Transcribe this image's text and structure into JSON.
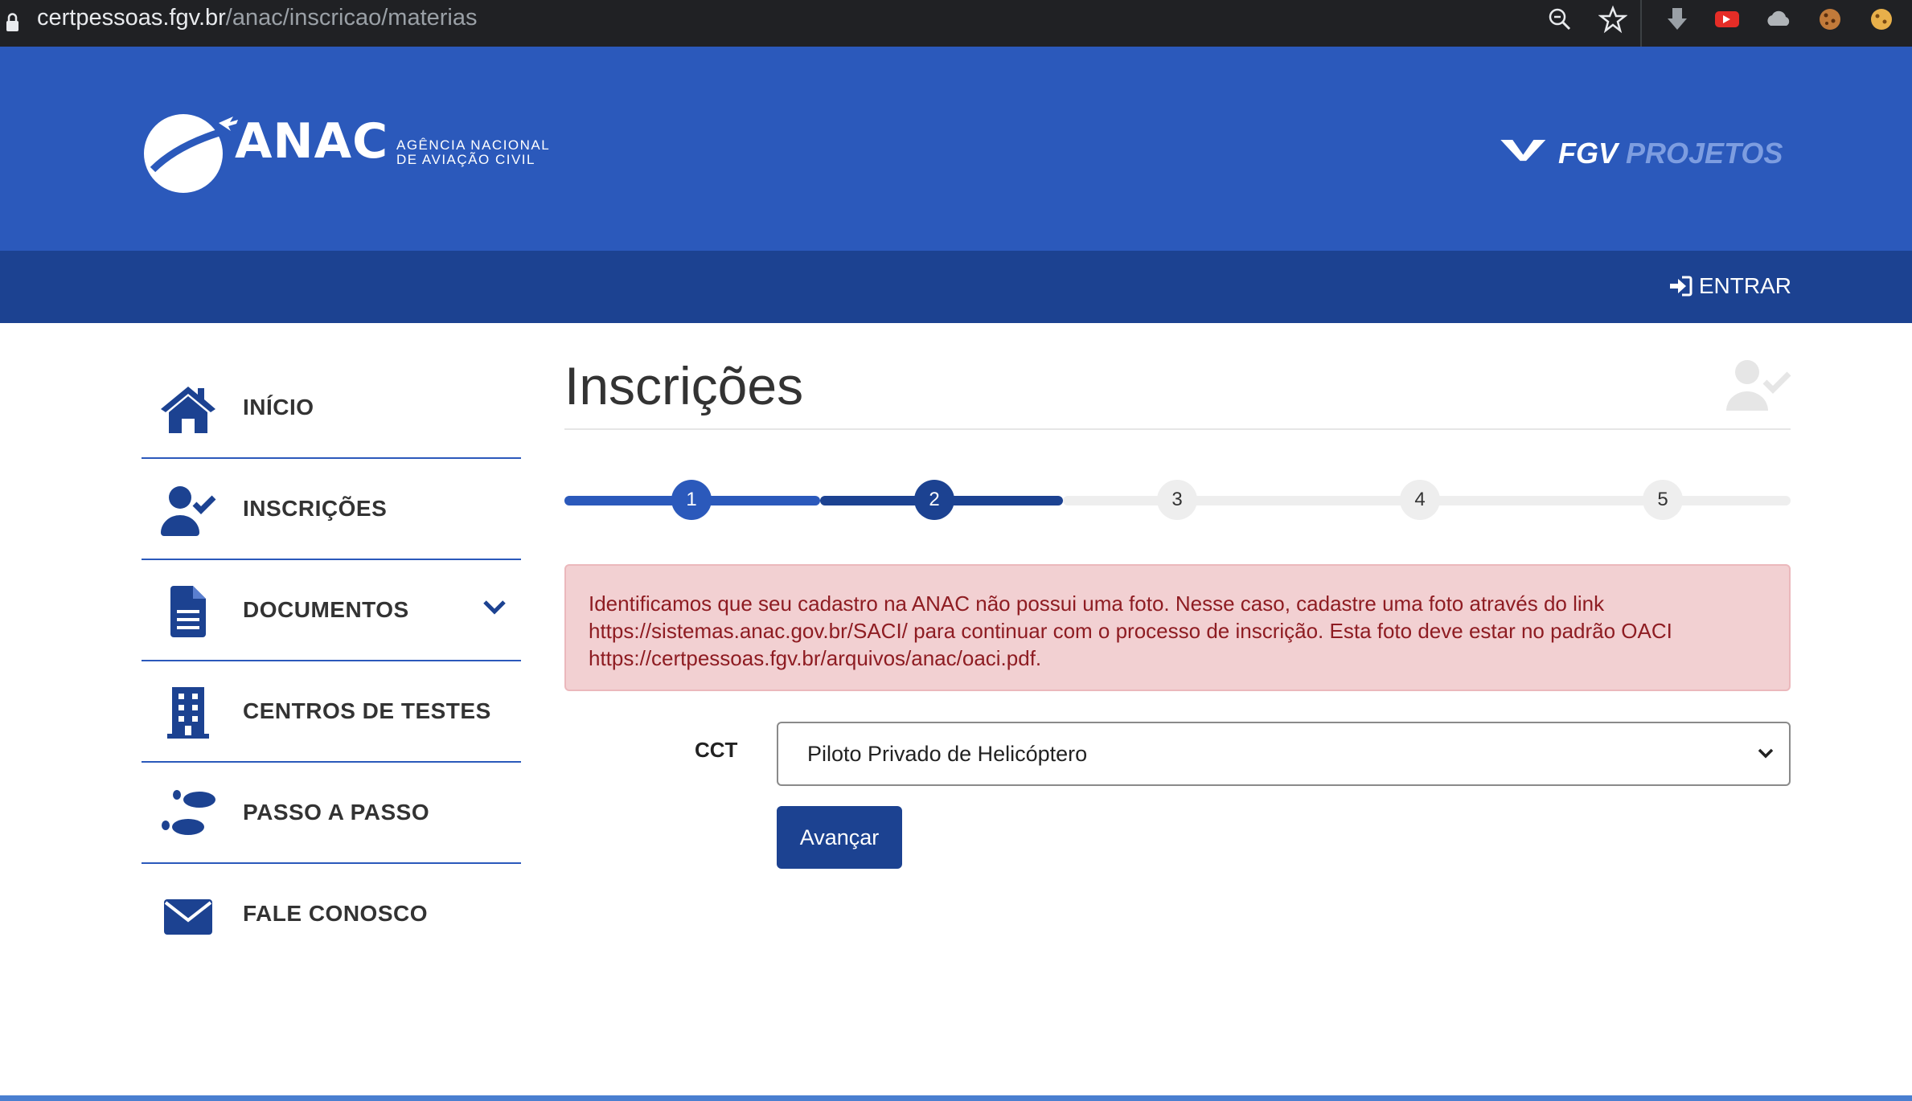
{
  "browser": {
    "url_domain": "certpessoas.fgv.br",
    "url_path": "/anac/inscricao/materias"
  },
  "header": {
    "anac_logo_text": "ANAC",
    "anac_subtitle_line1": "AGÊNCIA NACIONAL",
    "anac_subtitle_line2": "DE AVIAÇÃO CIVIL",
    "fgv_logo_text": "FGV",
    "fgv_logo_text2": " PROJETOS"
  },
  "navbar": {
    "login_label": "ENTRAR"
  },
  "sidebar": {
    "items": [
      {
        "label": "INÍCIO",
        "icon": "home-icon"
      },
      {
        "label": "INSCRIÇÕES",
        "icon": "user-check-icon"
      },
      {
        "label": "DOCUMENTOS",
        "icon": "document-icon"
      },
      {
        "label": "CENTROS DE TESTES",
        "icon": "building-icon"
      },
      {
        "label": "PASSO A PASSO",
        "icon": "footprints-icon"
      },
      {
        "label": "FALE CONOSCO",
        "icon": "envelope-icon"
      }
    ]
  },
  "main": {
    "title": "Inscrições",
    "stepper": {
      "steps": [
        "1",
        "2",
        "3",
        "4",
        "5"
      ],
      "current_step": 2
    },
    "alert": {
      "text": "Identificamos que seu cadastro na ANAC não possui uma foto. Nesse caso, cadastre uma foto através do link https://sistemas.anac.gov.br/SACI/ para continuar com o processo de inscrição. Esta foto deve estar no padrão OACI https://certpessoas.fgv.br/arquivos/anac/oaci.pdf."
    },
    "form": {
      "cct_label": "CCT",
      "cct_selected": "Piloto Privado de Helicóptero",
      "submit_label": "Avançar"
    }
  },
  "colors": {
    "header_blue": "#2b59bb",
    "nav_blue": "#1c4291",
    "alert_bg": "#f2d0d2",
    "alert_text": "#8e1c22"
  }
}
